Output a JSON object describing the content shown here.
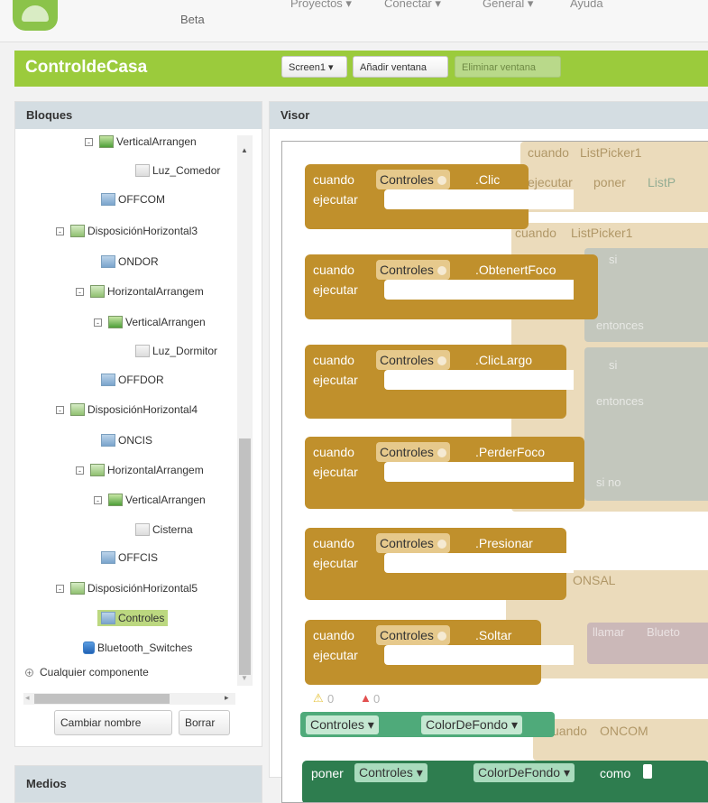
{
  "header": {
    "beta_label": "Beta",
    "menu": [
      "Proyectos ▾",
      "Conectar ▾",
      "General ▾",
      "Ayuda"
    ]
  },
  "project": {
    "name": "ControldeCasa",
    "screen_button": "Screen1 ▾",
    "add_screen": "Añadir ventana",
    "remove_screen": "Eliminar ventana"
  },
  "blocks_panel": {
    "title": "Bloques",
    "items": [
      "VerticalArrangen",
      "Luz_Comedor",
      "OFFCOM",
      "DisposiciónHorizontal3",
      "ONDOR",
      "HorizontalArrangem",
      "VerticalArrangen",
      "Luz_Dormitor",
      "OFFDOR",
      "DisposiciónHorizontal4",
      "ONCIS",
      "HorizontalArrangem",
      "VerticalArrangen",
      "Cisterna",
      "OFFCIS",
      "DisposiciónHorizontal5",
      "Controles",
      "Bluetooth_Switches",
      "Cualquier componente"
    ],
    "rename_button": "Cambiar nombre",
    "delete_button": "Borrar"
  },
  "media_panel": {
    "title": "Medios"
  },
  "viewer": {
    "title": "Visor",
    "kw_when": "cuando",
    "kw_do": "ejecutar",
    "component": "Controles",
    "events": [
      ".Clic",
      ".ObtenertFoco",
      ".ClicLargo",
      ".PerderFoco",
      ".Presionar",
      ".Soltar"
    ],
    "warnings": "0",
    "errors": "0",
    "getter_property": "ColorDeFondo",
    "setter_kw": "poner",
    "setter_to": "como",
    "ghost_texts": {
      "g1": "cuando",
      "g2": "ListPicker1",
      "g3": "ejecutar",
      "g4": "poner",
      "g5": "ListP",
      "g6": "cuando",
      "g7": "ListPicker1",
      "g8": "si",
      "g9": "entonces",
      "g10": "si",
      "g11": "entonces",
      "g12": "si no",
      "g13": "cuando",
      "g14": "ONSAL",
      "g15": "llamar",
      "g16": "Blueto",
      "g17": "cuando",
      "g18": "ONCOM"
    }
  },
  "colors": {
    "accent": "#9bcb3c",
    "event_block": "#c0902c",
    "component_block": "#4faa7a"
  }
}
